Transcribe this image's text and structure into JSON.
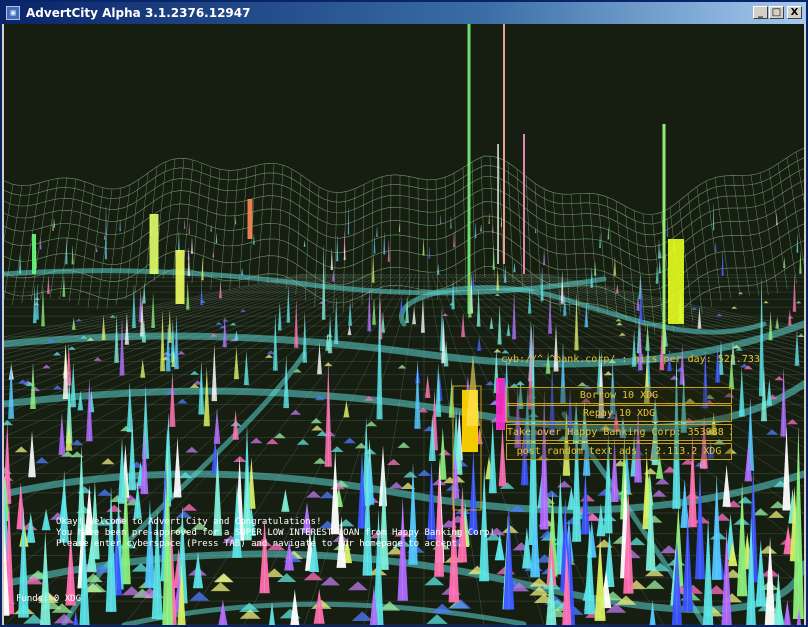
{
  "window": {
    "title": "AdvertCity Alpha 3.1.2376.12947",
    "icon_name": "app-window-icon",
    "controls": {
      "minimize": "_",
      "maximize": "□",
      "close": "X"
    }
  },
  "hud": {
    "address": "cyb://^_^bank.corp/ : hits per day: 522.733",
    "menu": [
      {
        "id": "borrow",
        "label": "Borrow 10 XDG"
      },
      {
        "id": "repay",
        "label": "Repay 10 XDG"
      },
      {
        "id": "takeover",
        "label": "Take over Happy Banking Corp: 353988 XDG"
      },
      {
        "id": "post",
        "label": "post random text ads : 2.113.2 XDG"
      }
    ],
    "message_lines": [
      "Okay! Welcome to Advert City and Congratulations!",
      "You have been pre-approved for a SUPER LOW INTEREST LOAN from Happy Banking Corp!",
      "Please enter cyberspace (Press TAB) and navigate to our homepage to accept."
    ],
    "funds": "Funds: 0 XDG"
  },
  "colors": {
    "sky": "#161e12",
    "terrain": "#7fb37a",
    "grid": "#9ab8a0",
    "road": "#5fd6d0",
    "hud": "#e8c23a",
    "highlight": "#ffd400"
  }
}
